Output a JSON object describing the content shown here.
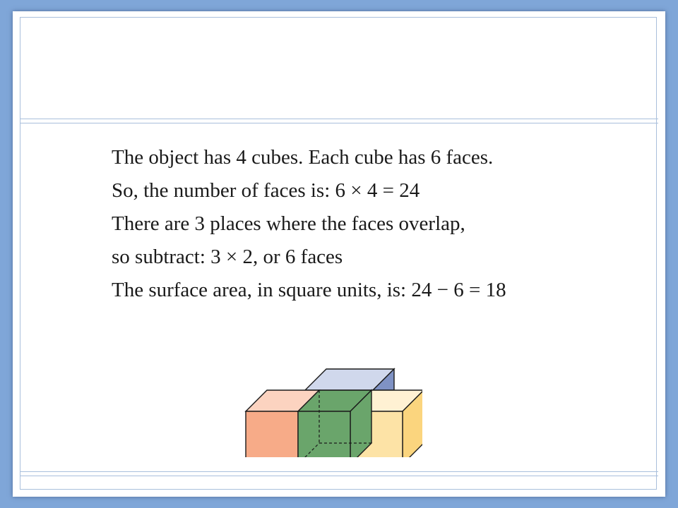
{
  "explanation": {
    "lines": [
      "The object has 4 cubes. Each cube has 6 faces.",
      "So, the number of faces is: 6 × 4 = 24",
      "There are 3 places where the faces overlap,",
      "so subtract: 3 × 2, or 6 faces",
      "The surface area, in square units, is: 24 − 6 = 18"
    ]
  },
  "figure": {
    "colors": {
      "left_cube": "#f7ab88",
      "left_cube_top": "#fcd3c0",
      "middle_cube": "#6aa56b",
      "middle_cube_bottom": "#cde0c4",
      "right_cube": "#fde3a6",
      "right_cube_side": "#fbd57e",
      "right_cube_top": "#fff1d3",
      "back_cube_top": "#d0d8ec",
      "back_cube_side": "#7f92c4",
      "outline": "#1a1a1a"
    }
  }
}
